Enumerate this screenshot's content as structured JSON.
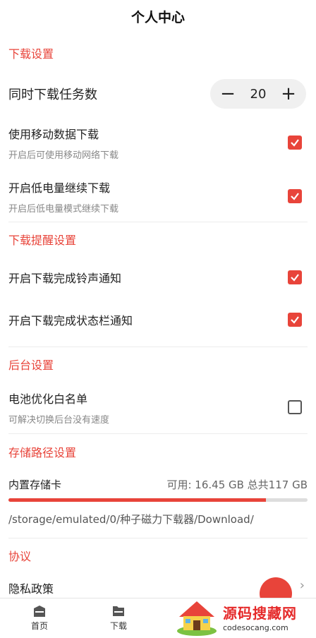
{
  "header": {
    "title": "个人中心"
  },
  "download": {
    "section_title": "下载设置",
    "concurrent_label": "同时下载任务数",
    "concurrent_value": "20",
    "minus_glyph": "−",
    "plus_glyph": "+",
    "mobile_title": "使用移动数据下载",
    "mobile_sub": "开启后可使用移动网络下载",
    "mobile_checked": true,
    "lowbattery_title": "开启低电量继续下载",
    "lowbattery_sub": "开启后低电量模式继续下载",
    "lowbattery_checked": true
  },
  "reminder": {
    "section_title": "下载提醒设置",
    "ringtone_title": "开启下载完成铃声通知",
    "ringtone_checked": true,
    "statusbar_title": "开启下载完成状态栏通知",
    "statusbar_checked": true
  },
  "background": {
    "section_title": "后台设置",
    "battery_title": "电池优化白名单",
    "battery_sub": "可解决切换后台没有速度",
    "battery_checked": false
  },
  "storage": {
    "section_title": "存储路径设置",
    "card_label": "内置存储卡",
    "info": "可用: 16.45 GB 总共117 GB",
    "used_fraction": 0.86,
    "path": "/storage/emulated/0/种子磁力下载器/Download/"
  },
  "agreement": {
    "section_title": "协议",
    "privacy_label": "隐私政策",
    "chevron": "›"
  },
  "nav": {
    "home_label": "首页",
    "download_label": "下载"
  },
  "watermark": {
    "text_cn": "源码搜藏网",
    "text_en": "codesocang.com"
  },
  "colors": {
    "accent": "#e8443a"
  },
  "icons": [
    "check-icon",
    "home-icon",
    "folder-icon",
    "chevron-right-icon"
  ]
}
